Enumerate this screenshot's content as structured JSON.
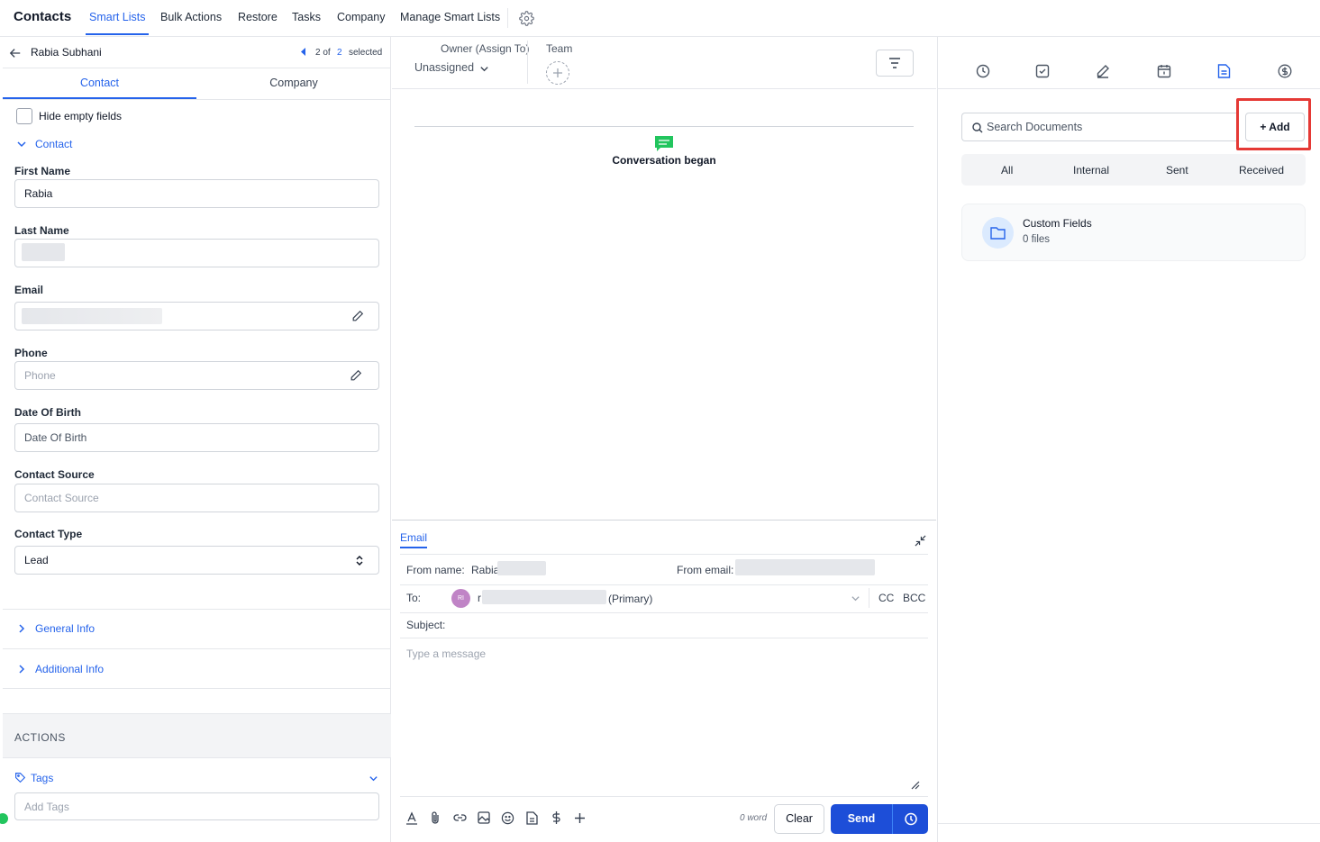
{
  "topnav": {
    "brand": "Contacts",
    "tabs": [
      "Smart Lists",
      "Bulk Actions",
      "Restore",
      "Tasks",
      "Company",
      "Manage Smart Lists"
    ]
  },
  "contact_header": {
    "name": "Rabia Subhani",
    "pager_current": "2 of",
    "pager_total": "2",
    "pager_selected": "selected"
  },
  "panel_tabs": [
    "Contact",
    "Company"
  ],
  "hide_empty_label": "Hide empty fields",
  "contact_section": "Contact",
  "fields": {
    "first_name_label": "First Name",
    "first_name_value": "Rabia",
    "last_name_label": "Last Name",
    "email_label": "Email",
    "phone_label": "Phone",
    "phone_placeholder": "Phone",
    "dob_label": "Date Of Birth",
    "dob_placeholder": "Date Of Birth",
    "source_label": "Contact Source",
    "source_placeholder": "Contact Source",
    "type_label": "Contact Type",
    "type_value": "Lead"
  },
  "collapsed_sections": [
    "General Info",
    "Additional Info"
  ],
  "actions_heading": "ACTIONS",
  "tags": {
    "label": "Tags",
    "placeholder": "Add Tags"
  },
  "owner": {
    "label": "Owner (Assign To)",
    "value": "Unassigned",
    "team_label": "Team"
  },
  "conversation_event": "Conversation began",
  "composer": {
    "tab": "Email",
    "from_name_label": "From name:",
    "from_name_value": "Rabia",
    "from_email_label": "From email:",
    "to_label": "To:",
    "to_avatar": "RI",
    "to_prefix": "r",
    "to_suffix": "(Primary)",
    "cc": "CC",
    "bcc": "BCC",
    "subject_label": "Subject:",
    "message_placeholder": "Type a message",
    "word_count": "0 word",
    "clear": "Clear",
    "send": "Send"
  },
  "documents": {
    "search_placeholder": "Search Documents",
    "add": "+ Add",
    "filters": [
      "All",
      "Internal",
      "Sent",
      "Received"
    ],
    "folder_name": "Custom Fields",
    "folder_count": "0 files"
  },
  "colors": {
    "accent": "#2563eb",
    "highlight": "#e53935",
    "chat_green": "#22c55e",
    "avatar_purple": "#c084c6"
  }
}
